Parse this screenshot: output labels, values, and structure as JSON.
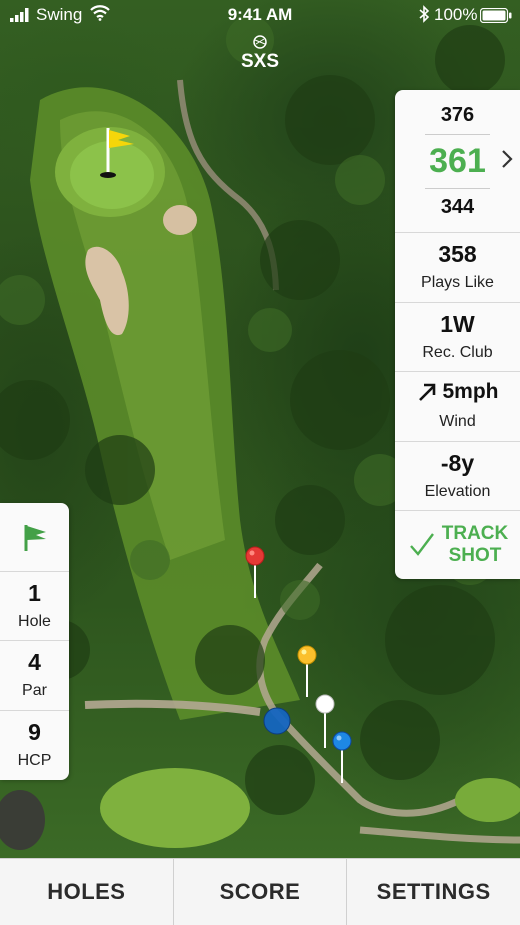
{
  "status_bar": {
    "carrier": "Swing",
    "time": "9:41 AM",
    "battery": "100%"
  },
  "app": {
    "logo_text": "SXS"
  },
  "distances": {
    "back": "376",
    "middle": "361",
    "front": "344"
  },
  "stats": [
    {
      "value": "358",
      "label": "Plays Like"
    },
    {
      "value": "1W",
      "label": "Rec. Club"
    },
    {
      "value": "5mph",
      "label": "Wind"
    },
    {
      "value": "-8y",
      "label": "Elevation"
    }
  ],
  "track_shot": {
    "line1": "TRACK",
    "line2": "SHOT"
  },
  "hole_info": [
    {
      "value": "1",
      "label": "Hole"
    },
    {
      "value": "4",
      "label": "Par"
    },
    {
      "value": "9",
      "label": "HCP"
    }
  ],
  "tabs": [
    "HOLES",
    "SCORE",
    "SETTINGS"
  ],
  "icons": {
    "signal": "signal-bars-icon",
    "wifi": "wifi-icon",
    "bluetooth": "bluetooth-icon",
    "battery": "battery-icon",
    "chevron": "chevron-right-icon",
    "wind": "arrow-up-right-icon",
    "check": "check-icon",
    "flag": "flag-icon"
  },
  "colors": {
    "accent_green": "#4caf50",
    "tee_red": "#e53935",
    "tee_yellow": "#fbc02d",
    "tee_white": "#ffffff",
    "tee_blue": "#1e88e5",
    "flag_yellow": "#f5d60a"
  }
}
